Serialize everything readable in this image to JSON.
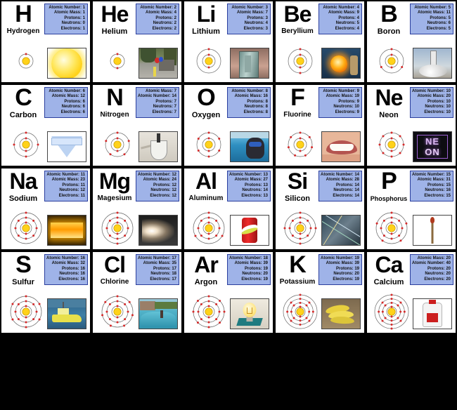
{
  "meta": {
    "title": "Periodic Table Element Cards — H through Ca",
    "label_keys": [
      "Atomic Number",
      "Atomic Mass",
      "Protons",
      "Neutrons",
      "Electrons"
    ],
    "colors": {
      "card_background": "#ffffff",
      "card_border": "#000000",
      "info_box_fill": "#9fb3e8",
      "info_box_border": "#2b3f9e",
      "nucleus": "#ffd21a",
      "electron": "#d42b2b",
      "shell_ring": "#6b6b6b",
      "page_background": "#000000"
    }
  },
  "elements": [
    {
      "symbol": "H",
      "name": "Hydrogen",
      "info": [
        "Atomic Number: 1",
        "Atomic Mass: 1",
        "Protons: 1",
        "Neutrons: 0",
        "Electrons: 1"
      ],
      "shells": [
        1
      ],
      "photo": "sun",
      "photo_alt": "the-sun-photo"
    },
    {
      "symbol": "He",
      "name": "Helium",
      "info": [
        "Atomic Number: 2",
        "Atomic Mass: 4",
        "Protons: 2",
        "Neutrons: 2",
        "Electrons: 2"
      ],
      "shells": [
        2
      ],
      "photo": "street",
      "photo_alt": "balloons-on-street-photo"
    },
    {
      "symbol": "Li",
      "name": "Lithium",
      "info": [
        "Atomic Number: 3",
        "Atomic Mass: 7",
        "Protons: 3",
        "Neutrons: 4",
        "Electrons: 3"
      ],
      "shells": [
        2,
        1
      ],
      "photo": "liquid",
      "photo_alt": "lithium-metal-in-jar-photo"
    },
    {
      "symbol": "Be",
      "name": "Beryllium",
      "info": [
        "Atomic Number: 4",
        "Atomic Mass: 9",
        "Protons: 4",
        "Neutrons: 5",
        "Electrons: 4"
      ],
      "shells": [
        2,
        2
      ],
      "photo": "molten",
      "photo_alt": "molten-metal-foundry-photo"
    },
    {
      "symbol": "B",
      "name": "Boron",
      "info": [
        "Atomic Number: 5",
        "Atomic Mass: 11",
        "Protons: 5",
        "Neutrons: 6",
        "Electrons: 5"
      ],
      "shells": [
        2,
        3
      ],
      "photo": "rocket",
      "photo_alt": "rocket-launch-photo"
    },
    {
      "symbol": "C",
      "name": "Carbon",
      "info": [
        "Atomic Number: 6",
        "Atomic Mass: 12",
        "Protons: 6",
        "Neutrons: 6",
        "Electrons: 6"
      ],
      "shells": [
        2,
        4
      ],
      "photo": "diamond",
      "photo_alt": "diamond-photo"
    },
    {
      "symbol": "N",
      "name": "Nitrogen",
      "info": [
        "Atomic Mass: 7",
        "Atomic Number: 14",
        "Protons: 7",
        "Neutrons: 7",
        "Electrons: 7"
      ],
      "shells": [
        2,
        5
      ],
      "photo": "lab",
      "photo_alt": "liquid-nitrogen-flask-photo"
    },
    {
      "symbol": "O",
      "name": "Oxygen",
      "info": [
        "Atomic Number: 8",
        "Atomic Mass: 16",
        "Protons: 8",
        "Neutrons: 8",
        "Electrons: 8"
      ],
      "shells": [
        2,
        6
      ],
      "photo": "diver",
      "photo_alt": "scuba-diver-photo"
    },
    {
      "symbol": "F",
      "name": "Fluorine",
      "info": [
        "Atomic Number: 9",
        "Atomic Mass: 19",
        "Protons: 9",
        "Neutrons: 10",
        "Electrons: 9"
      ],
      "shells": [
        2,
        7
      ],
      "photo": "smile",
      "photo_alt": "smiling-teeth-photo"
    },
    {
      "symbol": "Ne",
      "name": "Neon",
      "info": [
        "Atomic Number: 10",
        "Atomic Mass: 20",
        "Protons: 10",
        "Neutrons: 10",
        "Electrons: 10"
      ],
      "shells": [
        2,
        8
      ],
      "photo": "neon",
      "photo_alt": "neon-sign-photo",
      "photo_text": {
        "line1": "NE",
        "line2": "ON"
      }
    },
    {
      "symbol": "Na",
      "name": "Sodium",
      "info": [
        "Atomic Number: 11",
        "Atomic Mass: 23",
        "Protons: 11",
        "Neutrons: 12",
        "Electrons: 11"
      ],
      "shells": [
        2,
        8,
        1
      ],
      "photo": "sodiumlamp",
      "photo_alt": "sodium-vapor-lamp-photo"
    },
    {
      "symbol": "Mg",
      "name": "Magesium",
      "info": [
        "Atomic Number: 12",
        "Atomic Mass: 24",
        "Protons: 12",
        "Neutrons: 12",
        "Electrons: 12"
      ],
      "shells": [
        2,
        8,
        2
      ],
      "photo": "sparks",
      "photo_alt": "magnesium-sparks-photo"
    },
    {
      "symbol": "Al",
      "name": "Aluminum",
      "info": [
        "Atomic Number: 13",
        "Atomic Mass: 27",
        "Protons: 13",
        "Neutrons: 14",
        "Electrons: 13"
      ],
      "shells": [
        2,
        8,
        3
      ],
      "photo": "soda",
      "photo_alt": "aluminum-soda-can-photo"
    },
    {
      "symbol": "Si",
      "name": "Silicon",
      "info": [
        "Atomic Number: 14",
        "Atomic Mass: 28",
        "Protons: 14",
        "Neutrons: 14",
        "Electrons: 14"
      ],
      "shells": [
        2,
        8,
        4
      ],
      "photo": "wafer",
      "photo_alt": "silicon-chip-wafer-photo"
    },
    {
      "symbol": "P",
      "name": "Phosphorus",
      "info": [
        "Atomic Number: 15",
        "Atomic Mass: 31",
        "Protons: 15",
        "Neutrons: 16",
        "Electrons: 15"
      ],
      "shells": [
        2,
        8,
        5
      ],
      "photo": "match",
      "photo_alt": "matchstick-photo"
    },
    {
      "symbol": "S",
      "name": "Sulfur",
      "info": [
        "Atomic Number: 16",
        "Atomic Mass: 32",
        "Protons: 16",
        "Neutrons: 16",
        "Electrons: 16"
      ],
      "shells": [
        2,
        8,
        6
      ],
      "photo": "boat",
      "photo_alt": "yellow-sulfur-ship-photo"
    },
    {
      "symbol": "Cl",
      "name": "Chlorine",
      "info": [
        "Atomic Number: 17",
        "Atomic Mass: 35",
        "Protons: 17",
        "Neutrons: 18",
        "Electrons: 17"
      ],
      "shells": [
        2,
        8,
        7
      ],
      "photo": "pool",
      "photo_alt": "swimming-pool-photo"
    },
    {
      "symbol": "Ar",
      "name": "Argon",
      "info": [
        "Atomic Number: 18",
        "Atomic Mass: 39",
        "Protons: 19",
        "Neutrons: 20",
        "Electrons: 19"
      ],
      "shells": [
        2,
        8,
        8
      ],
      "photo": "bulb",
      "photo_alt": "light-bulb-photo"
    },
    {
      "symbol": "K",
      "name": "Potassium",
      "info": [
        "Atomic Number: 19",
        "Atomic Mass: 39",
        "Protons: 19",
        "Neutrons: 20",
        "Electrons: 19"
      ],
      "shells": [
        2,
        8,
        8,
        1
      ],
      "photo": "bananas",
      "photo_alt": "bananas-photo"
    },
    {
      "symbol": "Ca",
      "name": "Calcium",
      "info": [
        "Atomic Mass: 20",
        "Atomic Number: 40",
        "Protons: 20",
        "Neutrons: 20",
        "Electrons: 20"
      ],
      "shells": [
        2,
        8,
        8,
        2
      ],
      "photo": "milk",
      "photo_alt": "milk-jug-photo"
    }
  ]
}
